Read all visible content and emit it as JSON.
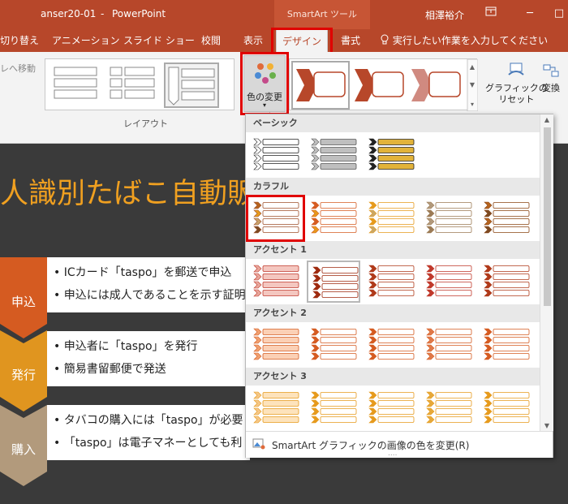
{
  "titlebar": {
    "filename": "anser20-01",
    "separator": "-",
    "app": "PowerPoint",
    "context_tool": "SmartArt ツール",
    "user": "相澤裕介",
    "window_icon": "ribbon-display-options-icon",
    "minimize": "─",
    "restore": "□"
  },
  "tabs": [
    {
      "label": "切り替え"
    },
    {
      "label": "アニメーション"
    },
    {
      "label": "スライド ショー"
    },
    {
      "label": "校閲"
    },
    {
      "label": "表示"
    },
    {
      "label": "デザイン"
    },
    {
      "label": "書式"
    }
  ],
  "tell_me": "実行したい作業を入力してください",
  "ribbon": {
    "move_down_partial": "レへ移動",
    "layout_group": "レイアウト",
    "change_colors": "色の変更",
    "reset_graphic": [
      "グラフィックの",
      "リセット"
    ],
    "convert": "変換",
    "accent_color": "#b7472a"
  },
  "slide": {
    "title": "人識別たばこ自動販",
    "steps": [
      {
        "label": "申込",
        "color": "#d55b21",
        "bullets": [
          "• ICカード「taspo」を郵送で申込",
          "• 申込には成人であることを示す証明"
        ]
      },
      {
        "label": "発行",
        "color": "#e0951f",
        "bullets": [
          "• 申込者に「taspo」を発行",
          "• 簡易書留郵便で発送"
        ]
      },
      {
        "label": "購入",
        "color": "#b29a7c",
        "bullets": [
          "• タバコの購入には「taspo」が必要",
          "• 「taspo」は電子マネーとしても利"
        ]
      }
    ]
  },
  "dropdown": {
    "sections": [
      {
        "title": "ベーシック",
        "items": [
          {
            "fill": "#ffffff",
            "stroke": "#222222",
            "box": "#ffffff"
          },
          {
            "fill": "#bfbfbf",
            "stroke": "#555555",
            "box": "#bfbfbf"
          },
          {
            "fill": "#222222",
            "stroke": "#222222",
            "box": "#e2b33a"
          }
        ]
      },
      {
        "title": "カラフル",
        "items": [
          {
            "fill": [
              "#b5631e",
              "#e69a1c",
              "#c8a26a",
              "#7b4a22"
            ],
            "box": "#ffffff",
            "stroke": "#a0522d"
          },
          {
            "fill": [
              "#d55b21",
              "#e69a1c",
              "#d55b21",
              "#e69a1c"
            ],
            "box": "#ffffff",
            "stroke": "#d55b21"
          },
          {
            "fill": [
              "#e69a1c",
              "#c9a766",
              "#e69a1c",
              "#c9a766"
            ],
            "box": "#ffffff",
            "stroke": "#e69a1c"
          },
          {
            "fill": [
              "#b29a7c",
              "#9c7b55",
              "#b29a7c",
              "#9c7b55"
            ],
            "box": "#ffffff",
            "stroke": "#9c7b55"
          },
          {
            "fill": [
              "#b5631e",
              "#7b4a22",
              "#b5631e",
              "#7b4a22"
            ],
            "box": "#ffffff",
            "stroke": "#8b4513"
          }
        ]
      },
      {
        "title": "アクセント 1",
        "items": [
          {
            "fill": "#e8a79c",
            "stroke": "#c0392b",
            "box": "#f4c7c0"
          },
          {
            "fill": "#9e2a0f",
            "stroke": "#9e2a0f",
            "box": "#ffffff"
          },
          {
            "fill": "#b03a1a",
            "stroke": "#b03a1a",
            "box": "#ffffff"
          },
          {
            "fill": "#c0392b",
            "stroke": "#c0392b",
            "box": "#ffffff"
          },
          {
            "fill": "#b03a1a",
            "stroke": "#b03a1a",
            "box": "#ffffff"
          }
        ]
      },
      {
        "title": "アクセント 2",
        "items": [
          {
            "fill": "#f0a070",
            "stroke": "#d55b21",
            "box": "#fbd0b5"
          },
          {
            "fill": "#d55b21",
            "stroke": "#d55b21",
            "box": "#ffffff"
          },
          {
            "fill": "#d55b21",
            "stroke": "#d55b21",
            "box": "#ffffff"
          },
          {
            "fill": "#e07a4a",
            "stroke": "#d55b21",
            "box": "#ffffff"
          },
          {
            "fill": "#d55b21",
            "stroke": "#d55b21",
            "box": "#ffffff"
          }
        ]
      },
      {
        "title": "アクセント 3",
        "items": [
          {
            "fill": "#f5c787",
            "stroke": "#e69a1c",
            "box": "#fde3bc"
          },
          {
            "fill": "#e69a1c",
            "stroke": "#e69a1c",
            "box": "#ffffff"
          },
          {
            "fill": "#e69a1c",
            "stroke": "#e69a1c",
            "box": "#ffffff"
          },
          {
            "fill": "#e6a93a",
            "stroke": "#e69a1c",
            "box": "#ffffff"
          },
          {
            "fill": "#e69a1c",
            "stroke": "#e69a1c",
            "box": "#ffffff"
          }
        ]
      }
    ],
    "footer_label": "SmartArt グラフィックの画像の色を変更(R)",
    "grip": "....",
    "highlight_color": "#e00000"
  }
}
